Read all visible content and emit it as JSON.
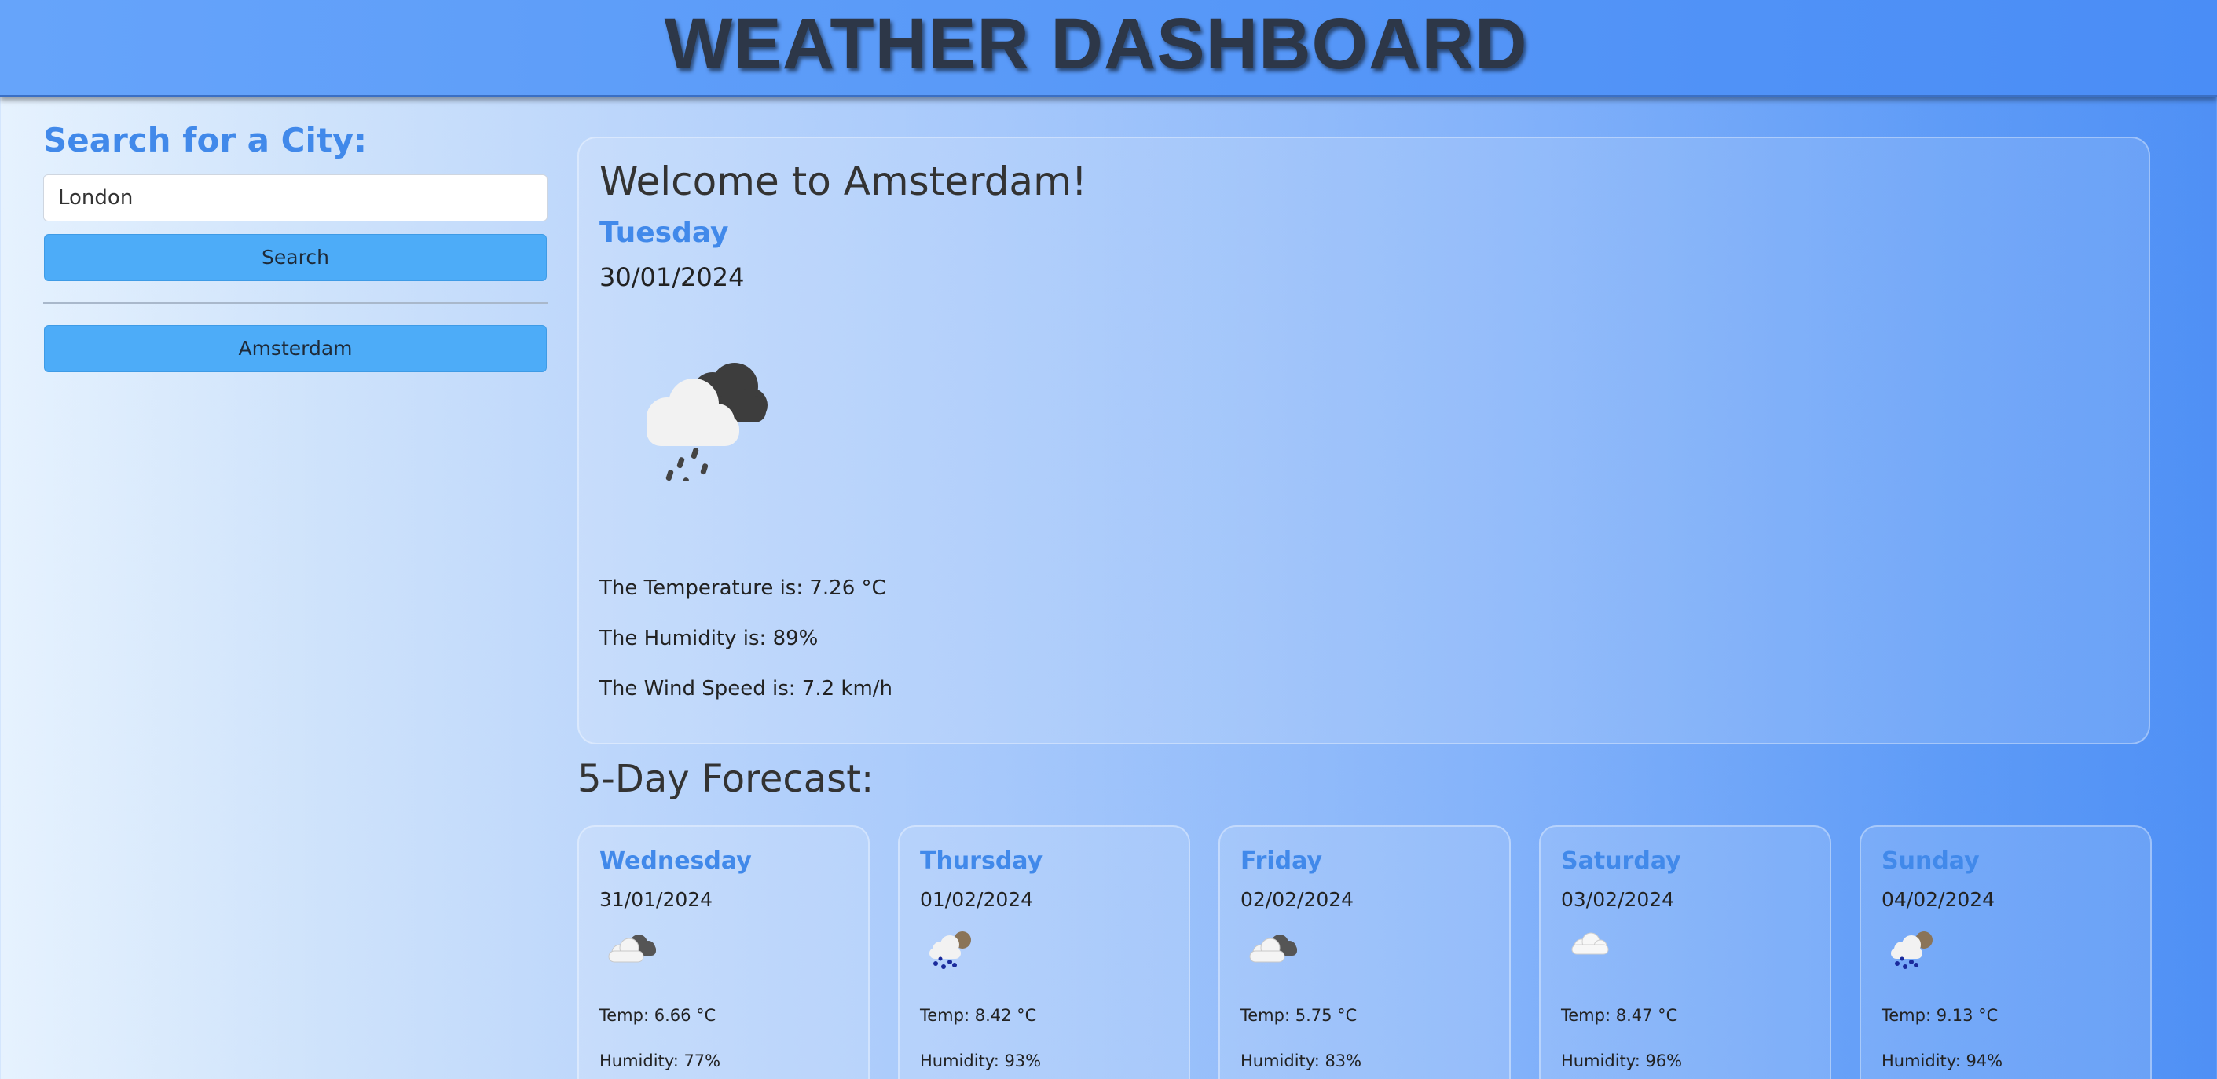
{
  "header": {
    "title": "WEATHER DASHBOARD"
  },
  "sidebar": {
    "heading": "Search for a City:",
    "search_value": "London",
    "search_button": "Search",
    "history": [
      "Amsterdam"
    ]
  },
  "current": {
    "welcome": "Welcome to Amsterdam!",
    "day": "Tuesday",
    "date": "30/01/2024",
    "icon": "rain-cloud-icon",
    "temperature": "The Temperature is: 7.26 °C",
    "humidity": "The Humidity is: 89%",
    "wind": "The Wind Speed is: 7.2 km/h"
  },
  "forecast": {
    "title": "5-Day Forecast:",
    "days": [
      {
        "day": "Wednesday",
        "date": "31/01/2024",
        "icon": "broken-clouds-icon",
        "temp": "Temp: 6.66 °C",
        "humidity": "Humidity: 77%"
      },
      {
        "day": "Thursday",
        "date": "01/02/2024",
        "icon": "rain-sun-cloud-icon",
        "temp": "Temp: 8.42 °C",
        "humidity": "Humidity: 93%"
      },
      {
        "day": "Friday",
        "date": "02/02/2024",
        "icon": "broken-clouds-icon",
        "temp": "Temp: 5.75 °C",
        "humidity": "Humidity: 83%"
      },
      {
        "day": "Saturday",
        "date": "03/02/2024",
        "icon": "cloud-icon",
        "temp": "Temp: 8.47 °C",
        "humidity": "Humidity: 96%"
      },
      {
        "day": "Sunday",
        "date": "04/02/2024",
        "icon": "rain-sun-cloud-icon",
        "temp": "Temp: 9.13 °C",
        "humidity": "Humidity: 94%"
      }
    ]
  },
  "colors": {
    "accent": "#4189ea",
    "button": "#4dacf8",
    "title_text": "#2d3748"
  }
}
